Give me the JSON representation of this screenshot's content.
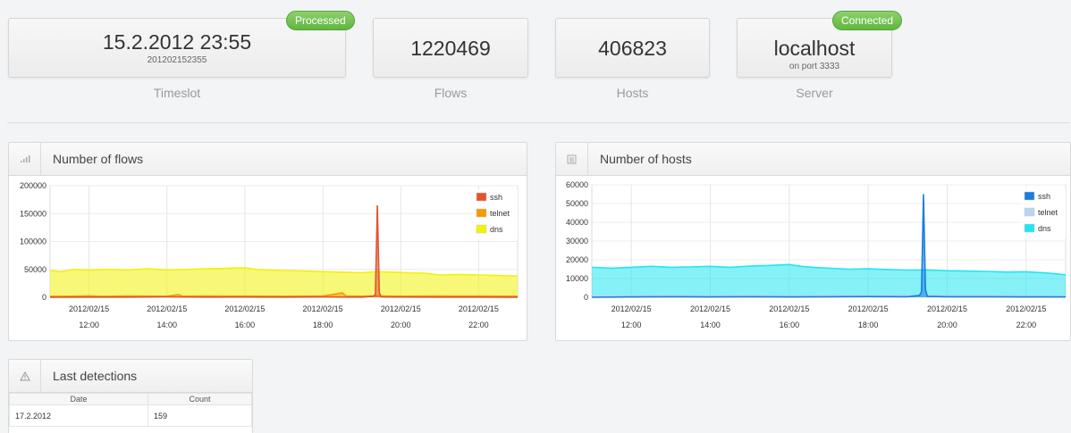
{
  "stats": [
    {
      "value": "15.2.2012 23:55",
      "sub": "201202152355",
      "label": "Timeslot",
      "badge": "Processed"
    },
    {
      "value": "1220469",
      "sub": "",
      "label": "Flows",
      "badge": ""
    },
    {
      "value": "406823",
      "sub": "",
      "label": "Hosts",
      "badge": ""
    },
    {
      "value": "localhost",
      "sub": "on port 3333",
      "label": "Server",
      "badge": "Connected"
    }
  ],
  "colors": {
    "badge_green": "#6cc24a",
    "flows_ssh": "#e4532f",
    "flows_telnet": "#f59a00",
    "flows_dns": "#f2f20a",
    "hosts_ssh": "#1a7de0",
    "hosts_telnet": "#b8d4f0",
    "hosts_dns": "#22e6f0"
  },
  "charts": {
    "flows": {
      "title": "Number of flows",
      "icon": "bar-chart-icon",
      "chart_data": {
        "type": "area",
        "x_ticks": [
          {
            "date": "2012/02/15",
            "time": "12:00"
          },
          {
            "date": "2012/02/15",
            "time": "14:00"
          },
          {
            "date": "2012/02/15",
            "time": "16:00"
          },
          {
            "date": "2012/02/15",
            "time": "18:00"
          },
          {
            "date": "2012/02/15",
            "time": "20:00"
          },
          {
            "date": "2012/02/15",
            "time": "22:00"
          }
        ],
        "y_ticks": [
          "0",
          "50000",
          "100000",
          "150000",
          "200000"
        ],
        "ylim": [
          0,
          200000
        ],
        "xlim_hours": [
          11,
          23
        ],
        "series": [
          {
            "name": "ssh",
            "color": "#e4532f",
            "points": [
              [
                11,
                0
              ],
              [
                12,
                300
              ],
              [
                13,
                400
              ],
              [
                14,
                800
              ],
              [
                15,
                300
              ],
              [
                16,
                500
              ],
              [
                17,
                300
              ],
              [
                18,
                600
              ],
              [
                19,
                300
              ],
              [
                19.3,
                2000
              ],
              [
                19.35,
                5000
              ],
              [
                19.4,
                165000
              ],
              [
                19.45,
                8000
              ],
              [
                19.5,
                700
              ],
              [
                20,
                500
              ],
              [
                21,
                300
              ],
              [
                22,
                300
              ],
              [
                23,
                200
              ]
            ]
          },
          {
            "name": "telnet",
            "color": "#f59a00",
            "points": [
              [
                11,
                1800
              ],
              [
                11.5,
                2000
              ],
              [
                12,
                2500
              ],
              [
                12.3,
                1800
              ],
              [
                13,
                2200
              ],
              [
                14,
                2000
              ],
              [
                14.3,
                5000
              ],
              [
                14.4,
                2000
              ],
              [
                15,
                2200
              ],
              [
                16,
                2100
              ],
              [
                17,
                2000
              ],
              [
                18,
                2200
              ],
              [
                18.5,
                8000
              ],
              [
                18.6,
                2200
              ],
              [
                19,
                2000
              ],
              [
                19.4,
                2500
              ],
              [
                20,
                2000
              ],
              [
                21,
                2200
              ],
              [
                22,
                2100
              ],
              [
                23,
                2000
              ]
            ]
          },
          {
            "name": "dns",
            "color": "#f2f20a",
            "points": [
              [
                11,
                48000
              ],
              [
                11.3,
                46000
              ],
              [
                11.6,
                50000
              ],
              [
                12,
                49000
              ],
              [
                12.5,
                50000
              ],
              [
                13,
                49000
              ],
              [
                13.5,
                51000
              ],
              [
                14,
                49000
              ],
              [
                14.5,
                50000
              ],
              [
                15,
                51000
              ],
              [
                15.5,
                52000
              ],
              [
                16,
                53000
              ],
              [
                16.3,
                50000
              ],
              [
                16.6,
                49000
              ],
              [
                17,
                48000
              ],
              [
                17.5,
                47000
              ],
              [
                18,
                46000
              ],
              [
                18.5,
                45000
              ],
              [
                19,
                44000
              ],
              [
                19.4,
                46000
              ],
              [
                19.8,
                45000
              ],
              [
                20.2,
                44000
              ],
              [
                20.6,
                43000
              ],
              [
                21,
                40000
              ],
              [
                21.5,
                41000
              ],
              [
                22,
                40000
              ],
              [
                22.5,
                39000
              ],
              [
                23,
                38000
              ]
            ]
          }
        ]
      }
    },
    "hosts": {
      "title": "Number of hosts",
      "icon": "list-icon",
      "chart_data": {
        "type": "area",
        "x_ticks": [
          {
            "date": "2012/02/15",
            "time": "12:00"
          },
          {
            "date": "2012/02/15",
            "time": "14:00"
          },
          {
            "date": "2012/02/15",
            "time": "16:00"
          },
          {
            "date": "2012/02/15",
            "time": "18:00"
          },
          {
            "date": "2012/02/15",
            "time": "20:00"
          },
          {
            "date": "2012/02/15",
            "time": "22:00"
          }
        ],
        "y_ticks": [
          "0",
          "10000",
          "20000",
          "30000",
          "40000",
          "50000",
          "60000"
        ],
        "ylim": [
          0,
          60000
        ],
        "xlim_hours": [
          11,
          23
        ],
        "series": [
          {
            "name": "ssh",
            "color": "#1a7de0",
            "points": [
              [
                11,
                0
              ],
              [
                12,
                200
              ],
              [
                13,
                300
              ],
              [
                14,
                200
              ],
              [
                15,
                300
              ],
              [
                16,
                200
              ],
              [
                17,
                300
              ],
              [
                18,
                400
              ],
              [
                19,
                300
              ],
              [
                19.3,
                1000
              ],
              [
                19.35,
                3000
              ],
              [
                19.4,
                55000
              ],
              [
                19.45,
                4000
              ],
              [
                19.5,
                500
              ],
              [
                20,
                300
              ],
              [
                21,
                300
              ],
              [
                22,
                200
              ],
              [
                23,
                200
              ]
            ]
          },
          {
            "name": "telnet",
            "color": "#b8d4f0",
            "points": [
              [
                11,
                700
              ],
              [
                12,
                800
              ],
              [
                13,
                900
              ],
              [
                14,
                800
              ],
              [
                15,
                900
              ],
              [
                16,
                800
              ],
              [
                17,
                900
              ],
              [
                18,
                800
              ],
              [
                19,
                900
              ],
              [
                20,
                800
              ],
              [
                21,
                900
              ],
              [
                22,
                800
              ],
              [
                23,
                700
              ]
            ]
          },
          {
            "name": "dns",
            "color": "#22e6f0",
            "points": [
              [
                11,
                16000
              ],
              [
                11.5,
                15500
              ],
              [
                12,
                16000
              ],
              [
                12.5,
                16500
              ],
              [
                13,
                16000
              ],
              [
                13.5,
                16200
              ],
              [
                14,
                16500
              ],
              [
                14.5,
                16000
              ],
              [
                15,
                16600
              ],
              [
                15.5,
                17000
              ],
              [
                16,
                17500
              ],
              [
                16.3,
                16500
              ],
              [
                16.6,
                16000
              ],
              [
                17,
                15500
              ],
              [
                17.5,
                15000
              ],
              [
                18,
                15200
              ],
              [
                18.5,
                14800
              ],
              [
                19,
                14500
              ],
              [
                19.5,
                14600
              ],
              [
                20,
                14200
              ],
              [
                20.5,
                14000
              ],
              [
                21,
                13800
              ],
              [
                21.5,
                13500
              ],
              [
                22,
                13600
              ],
              [
                22.5,
                13000
              ],
              [
                23,
                12000
              ]
            ]
          }
        ]
      }
    }
  },
  "detections": {
    "title": "Last detections",
    "columns": [
      "Date",
      "Count"
    ],
    "rows": [
      [
        "17.2.2012",
        "159"
      ]
    ]
  }
}
